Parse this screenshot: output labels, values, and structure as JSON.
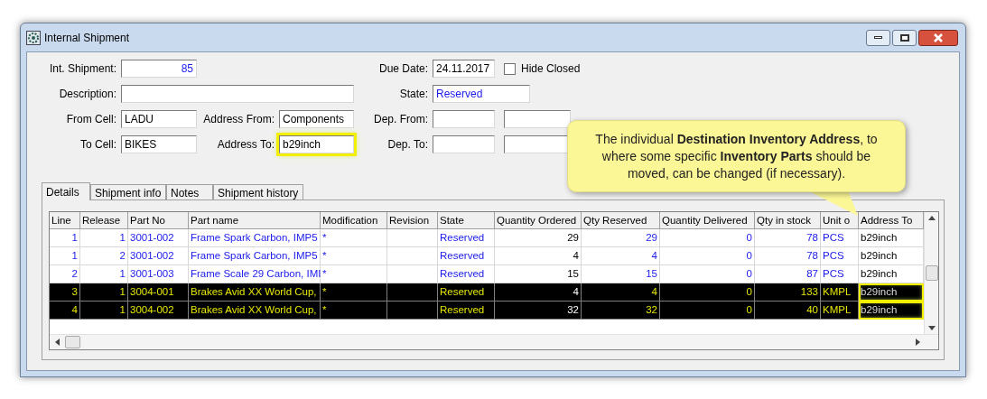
{
  "window": {
    "title": "Internal Shipment"
  },
  "form": {
    "int_shipment": {
      "label": "Int. Shipment:",
      "value": "85"
    },
    "due_date": {
      "label": "Due Date:",
      "value": "24.11.2017"
    },
    "hide_closed": {
      "label": "Hide Closed",
      "checked": false
    },
    "description": {
      "label": "Description:"
    },
    "state": {
      "label": "State:",
      "value": "Reserved"
    },
    "from_cell": {
      "label": "From Cell:",
      "value": "LADU"
    },
    "address_from": {
      "label": "Address From:",
      "value": "Components"
    },
    "dep_from": {
      "label": "Dep. From:"
    },
    "to_cell": {
      "label": "To Cell:",
      "value": "BIKES"
    },
    "address_to": {
      "label": "Address To:",
      "value": "b29inch",
      "highlighted": true
    },
    "dep_to": {
      "label": "Dep. To:"
    }
  },
  "tabs": [
    {
      "label": "Details",
      "selected": true
    },
    {
      "label": "Shipment info",
      "selected": false
    },
    {
      "label": "Notes",
      "selected": false
    },
    {
      "label": "Shipment history",
      "selected": false
    }
  ],
  "table": {
    "columns": [
      "Line",
      "Release",
      "Part No",
      "Part name",
      "Modification",
      "Revision",
      "State",
      "Quantity Ordered",
      "Qty Reserved",
      "Quantity Delivered",
      "Qty in stock",
      "Unit o",
      "Address To"
    ],
    "rows": [
      {
        "cells": [
          "1",
          "1",
          "3001-002",
          "Frame Spark Carbon, IMP5",
          "*",
          "",
          "Reserved",
          "29",
          "29",
          "0",
          "78",
          "PCS",
          "b29inch"
        ],
        "selected": false,
        "address_highlighted": false
      },
      {
        "cells": [
          "1",
          "2",
          "3001-002",
          "Frame Spark Carbon, IMP5",
          "*",
          "",
          "Reserved",
          "4",
          "4",
          "0",
          "78",
          "PCS",
          "b29inch"
        ],
        "selected": false,
        "address_highlighted": false
      },
      {
        "cells": [
          "2",
          "1",
          "3001-003",
          "Frame Scale 29 Carbon, IMI",
          "*",
          "",
          "Reserved",
          "15",
          "15",
          "0",
          "87",
          "PCS",
          "b29inch"
        ],
        "selected": false,
        "address_highlighted": false
      },
      {
        "cells": [
          "3",
          "1",
          "3004-001",
          "Brakes Avid XX World Cup,",
          "*",
          "",
          "Reserved",
          "4",
          "4",
          "0",
          "133",
          "KMPL",
          "b29inch"
        ],
        "selected": true,
        "address_highlighted": true
      },
      {
        "cells": [
          "4",
          "1",
          "3004-002",
          "Brakes Avid XX World Cup,",
          "*",
          "",
          "Reserved",
          "32",
          "32",
          "0",
          "40",
          "KMPL",
          "b29inch"
        ],
        "selected": true,
        "address_highlighted": true
      }
    ]
  },
  "callout": {
    "text": "The individual **Destination Inventory Address**, to where some specific **Inventory Parts** should be moved, can be changed (if necessary)."
  }
}
